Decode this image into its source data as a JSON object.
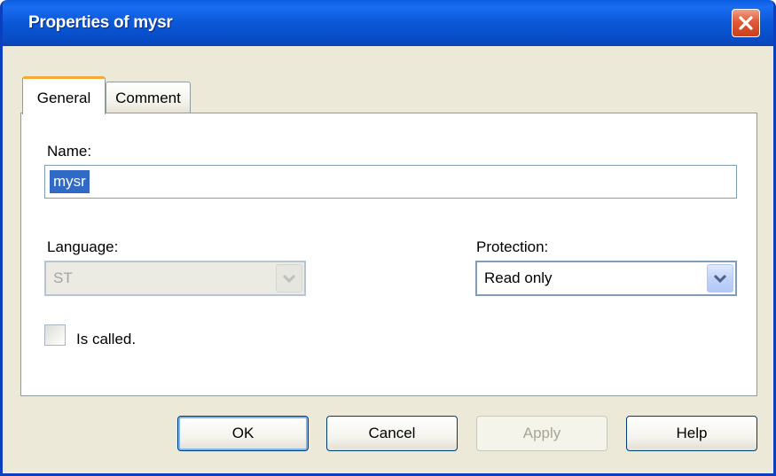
{
  "window": {
    "title": "Properties of mysr",
    "close_icon": "close-x-icon"
  },
  "tabs": [
    {
      "label": "General",
      "active": true
    },
    {
      "label": "Comment",
      "active": false
    }
  ],
  "general": {
    "name_label": "Name:",
    "name_value": "mysr",
    "language_label": "Language:",
    "language_value": "ST",
    "language_enabled": false,
    "protection_label": "Protection:",
    "protection_value": "Read only",
    "is_called_label": "Is called.",
    "is_called_checked": false
  },
  "buttons": {
    "ok": "OK",
    "cancel": "Cancel",
    "apply": "Apply",
    "help": "Help"
  },
  "colors": {
    "titlebar": "#0a5de0",
    "selection": "#316ac5",
    "close": "#e05a35",
    "active_tab_accent": "#f2a937"
  }
}
